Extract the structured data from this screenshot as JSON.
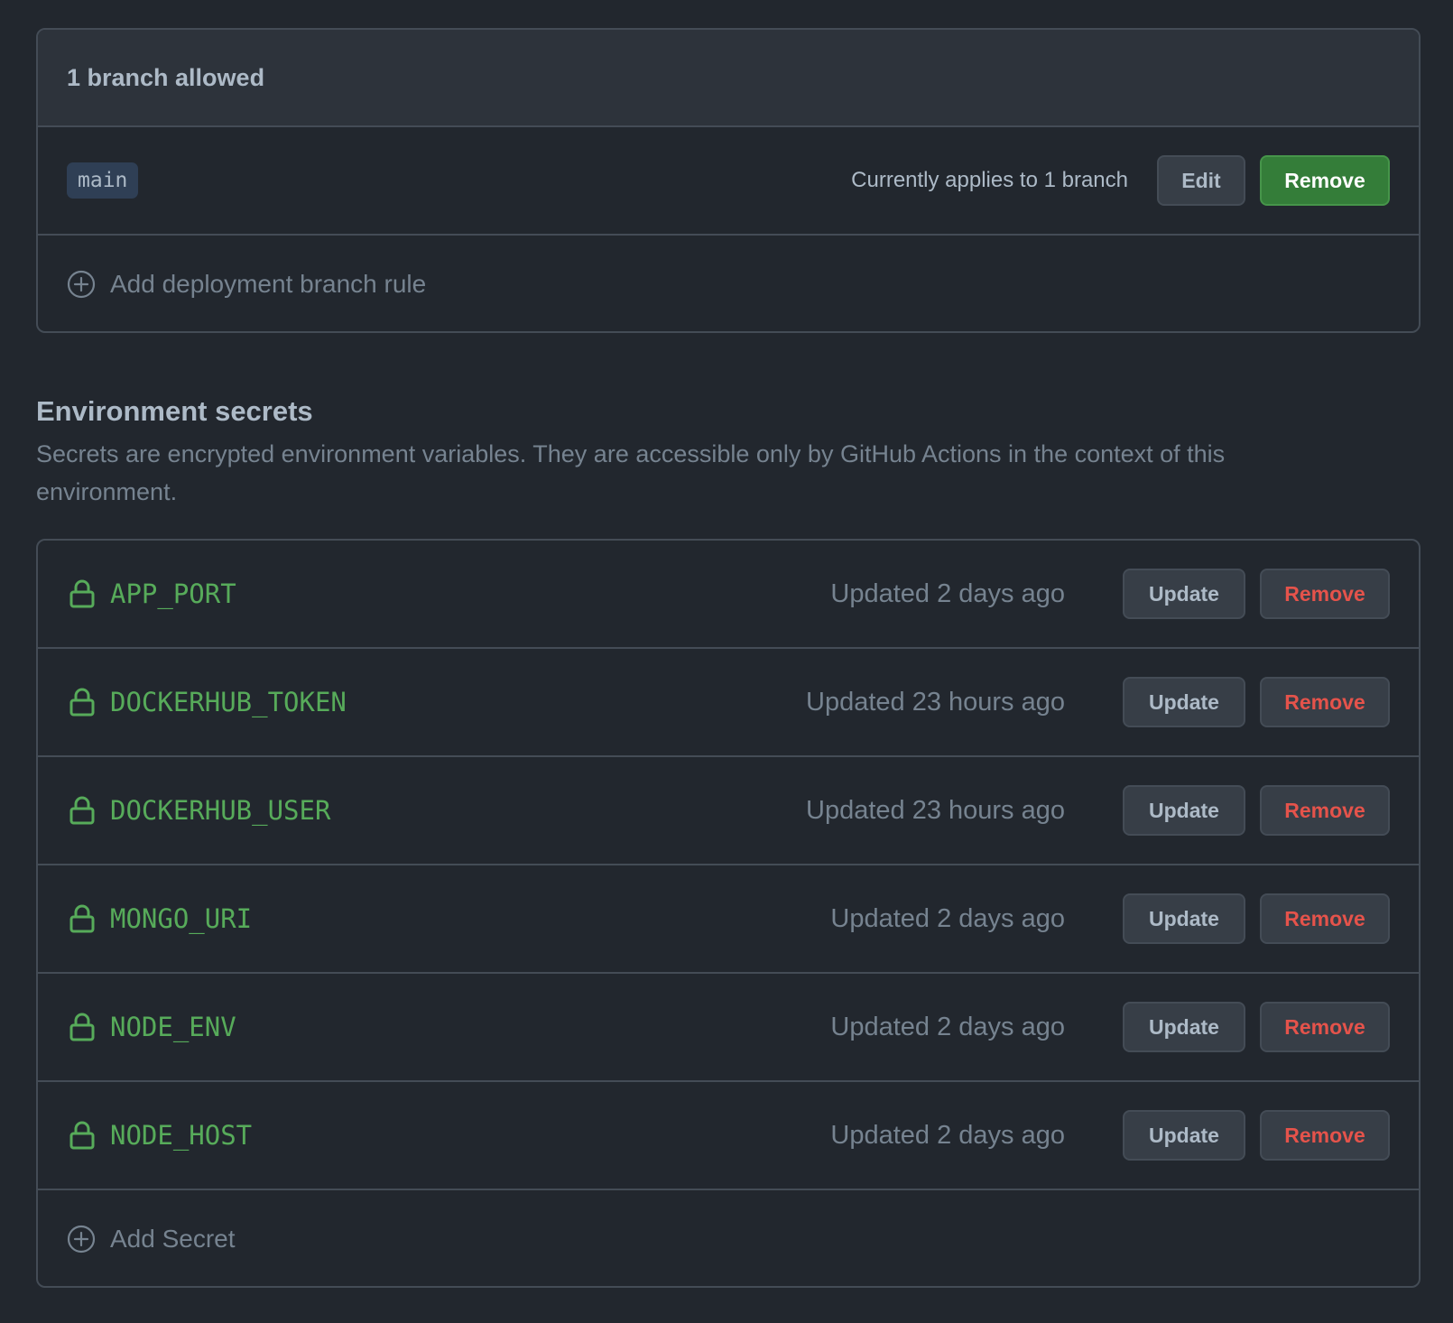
{
  "branch_policy": {
    "header": "1 branch allowed",
    "branches": [
      {
        "name": "main",
        "applies_text": "Currently applies to 1 branch",
        "edit_label": "Edit",
        "remove_label": "Remove"
      }
    ],
    "add_rule_label": "Add deployment branch rule"
  },
  "secrets": {
    "title": "Environment secrets",
    "description": "Secrets are encrypted environment variables. They are accessible only by GitHub Actions in the context of this environment.",
    "items": [
      {
        "name": "APP_PORT",
        "updated": "Updated 2 days ago",
        "update_label": "Update",
        "remove_label": "Remove"
      },
      {
        "name": "DOCKERHUB_TOKEN",
        "updated": "Updated 23 hours ago",
        "update_label": "Update",
        "remove_label": "Remove"
      },
      {
        "name": "DOCKERHUB_USER",
        "updated": "Updated 23 hours ago",
        "update_label": "Update",
        "remove_label": "Remove"
      },
      {
        "name": "MONGO_URI",
        "updated": "Updated 2 days ago",
        "update_label": "Update",
        "remove_label": "Remove"
      },
      {
        "name": "NODE_ENV",
        "updated": "Updated 2 days ago",
        "update_label": "Update",
        "remove_label": "Remove"
      },
      {
        "name": "NODE_HOST",
        "updated": "Updated 2 days ago",
        "update_label": "Update",
        "remove_label": "Remove"
      }
    ],
    "add_label": "Add Secret"
  },
  "icons": {
    "add": "plus-circle-icon",
    "secret": "lock-icon"
  },
  "colors": {
    "background": "#22272e",
    "header_bg": "#2d333b",
    "border": "#444c56",
    "secret_name": "#57ab5a",
    "danger": "#e5534b",
    "primary": "#347d39"
  }
}
